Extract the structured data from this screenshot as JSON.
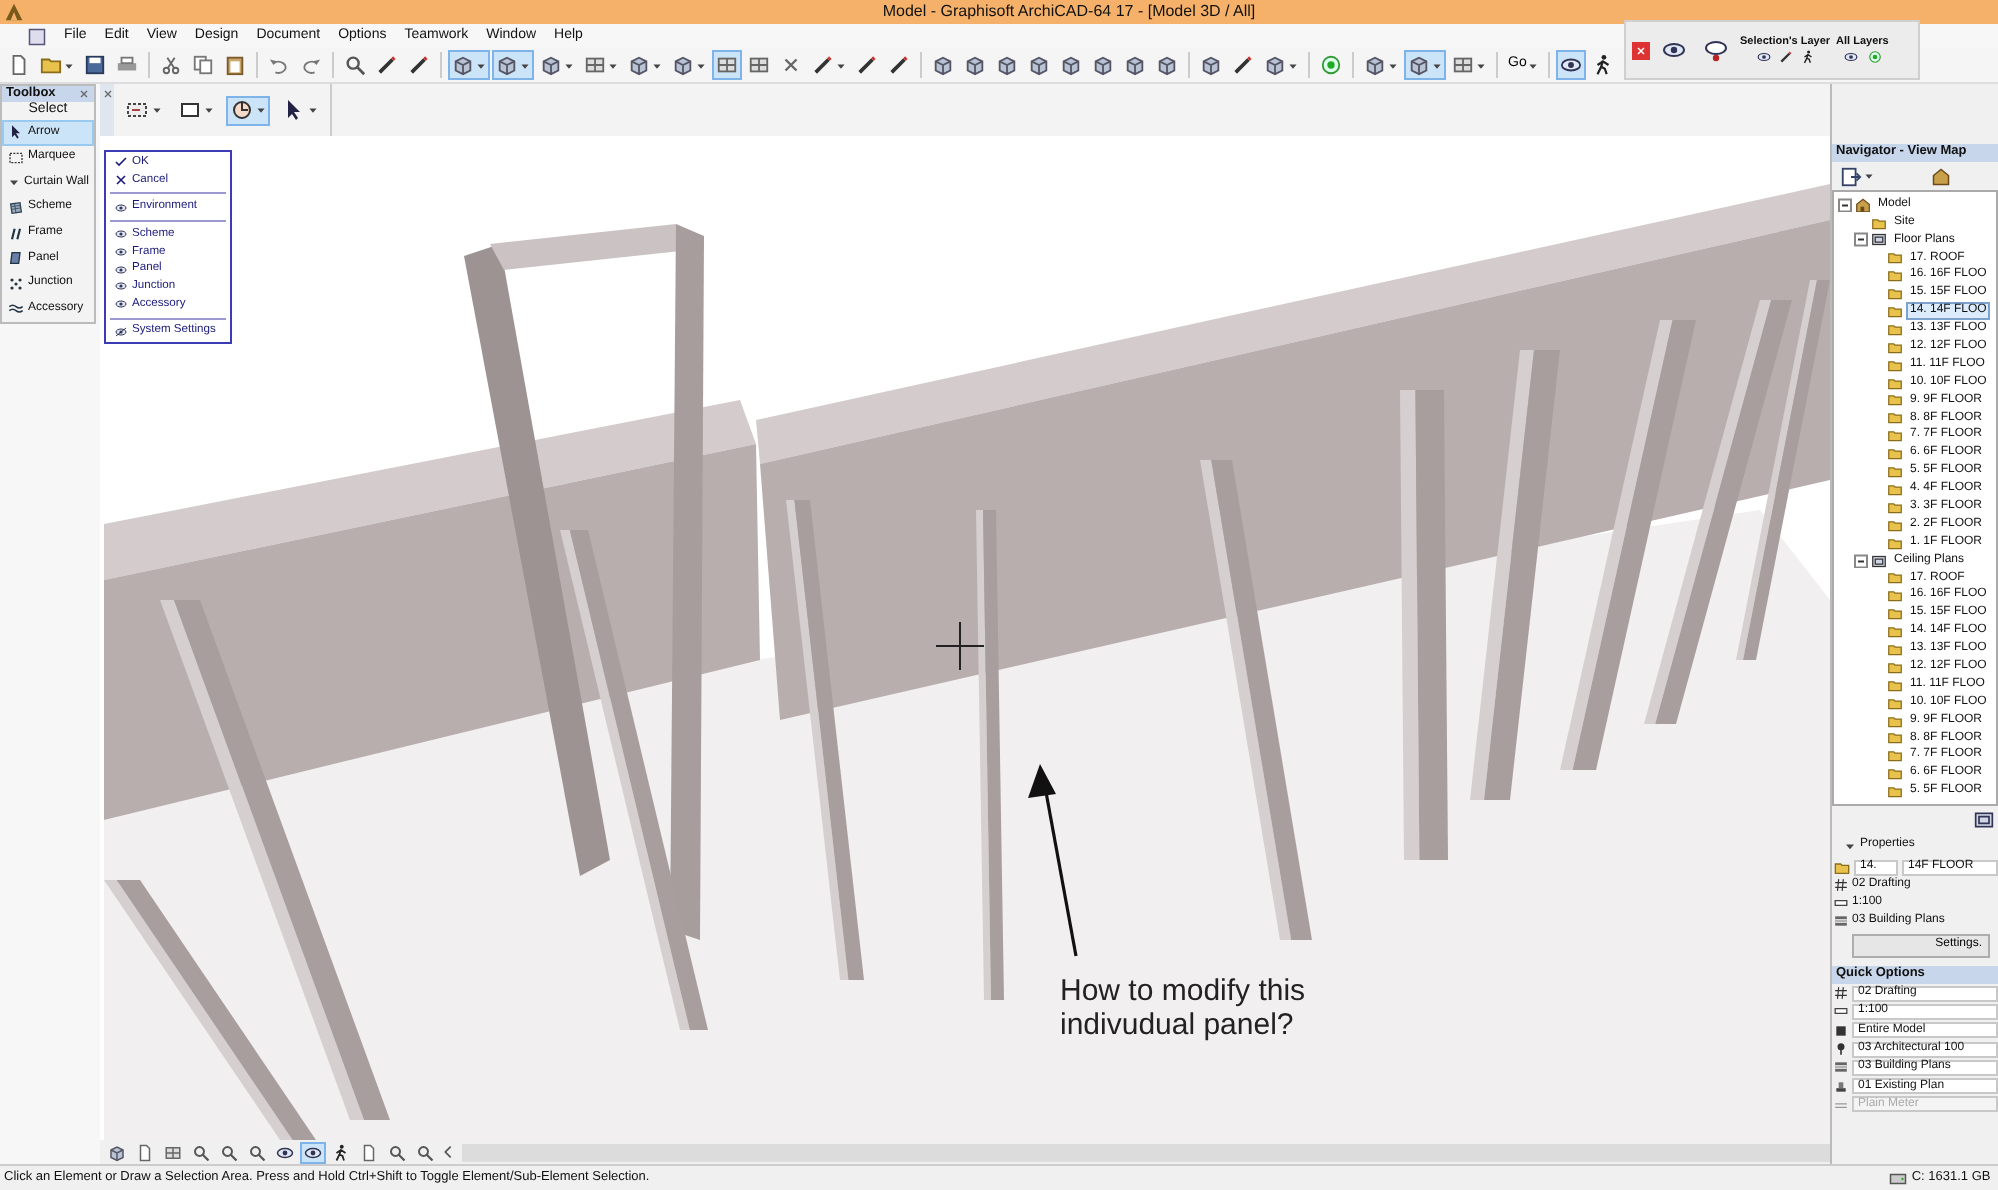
{
  "window": {
    "title": "Model - Graphisoft ArchiCAD-64 17 - [Model 3D / All]"
  },
  "menu": [
    "File",
    "Edit",
    "View",
    "Design",
    "Document",
    "Options",
    "Teamwork",
    "Window",
    "Help"
  ],
  "toolbar": {
    "buttons": [
      {
        "pressed": false
      },
      {
        "pressed": false
      },
      {
        "pressed": false
      },
      {
        "pressed": false
      },
      {
        "pressed": false
      },
      {
        "pressed": false
      },
      {
        "pressed": false
      },
      {
        "pressed": false
      },
      {
        "pressed": false
      },
      {
        "pressed": false
      },
      {
        "pressed": false
      },
      {
        "pressed": false
      },
      {
        "pressed": true
      },
      {
        "pressed": true
      },
      {
        "pressed": false
      },
      {
        "pressed": false
      },
      {
        "pressed": false
      },
      {
        "pressed": false
      },
      {
        "pressed": true
      },
      {
        "pressed": false
      },
      {
        "pressed": false
      },
      {
        "pressed": false
      },
      {
        "pressed": false
      },
      {
        "pressed": false
      },
      {
        "pressed": false
      },
      {
        "pressed": false
      },
      {
        "pressed": false
      },
      {
        "pressed": false
      },
      {
        "pressed": false
      },
      {
        "pressed": false
      },
      {
        "pressed": false
      },
      {
        "pressed": false
      },
      {
        "pressed": false
      },
      {
        "pressed": false
      },
      {
        "pressed": false
      },
      {
        "pressed": false
      },
      {
        "pressed": false
      },
      {
        "pressed": true
      },
      {
        "pressed": false
      },
      {
        "pressed": false,
        "label": "Go"
      },
      {
        "pressed": true
      },
      {
        "pressed": false
      }
    ]
  },
  "layers_palette": {
    "selection_layer": "Selection's Layer",
    "all_layers": "All Layers"
  },
  "info_box": {
    "buttons": [
      {
        "pressed": false
      },
      {
        "pressed": false
      },
      {
        "pressed": true
      },
      {
        "pressed": false
      }
    ]
  },
  "toolbox": {
    "title": "Toolbox",
    "section": "Select",
    "tools": [
      {
        "label": "Arrow",
        "selected": true
      },
      {
        "label": "Marquee",
        "selected": false
      }
    ],
    "group": {
      "label": "Curtain Wall",
      "expanded": true,
      "tools": [
        {
          "label": "Scheme",
          "selected": false
        },
        {
          "label": "Frame",
          "selected": false
        },
        {
          "label": "Panel",
          "selected": false
        },
        {
          "label": "Junction",
          "selected": false
        },
        {
          "label": "Accessory",
          "selected": false
        }
      ]
    }
  },
  "context_menu": {
    "items": [
      {
        "kind": "ok",
        "label": "OK"
      },
      {
        "kind": "cancel",
        "label": "Cancel"
      },
      {
        "kind": "separator"
      },
      {
        "kind": "eye",
        "label": "Environment"
      },
      {
        "kind": "separator"
      },
      {
        "kind": "eye",
        "label": "Scheme"
      },
      {
        "kind": "eye",
        "label": "Frame"
      },
      {
        "kind": "eye",
        "label": "Panel"
      },
      {
        "kind": "eye",
        "label": "Junction"
      },
      {
        "kind": "eye",
        "label": "Accessory"
      },
      {
        "kind": "separator"
      },
      {
        "kind": "settings",
        "label": "System Settings"
      }
    ]
  },
  "viewport": {
    "annotation": "How to modify this indivudual panel?"
  },
  "zoom_bar": {
    "buttons": [
      {
        "pressed": false
      },
      {
        "pressed": false
      },
      {
        "pressed": false
      },
      {
        "pressed": false
      },
      {
        "pressed": false
      },
      {
        "pressed": false
      },
      {
        "pressed": false
      },
      {
        "pressed": true
      },
      {
        "pressed": false
      },
      {
        "pressed": false
      },
      {
        "pressed": false
      },
      {
        "pressed": false
      }
    ]
  },
  "navigator": {
    "title": "Navigator - View Map",
    "tree": [
      {
        "label": "Model",
        "selected": false,
        "expanded": true,
        "children": [
          {
            "label": "Site",
            "selected": false
          },
          {
            "label": "Floor Plans",
            "selected": false,
            "expanded": true,
            "children": [
              {
                "label": "17. ROOF",
                "selected": false
              },
              {
                "label": "16. 16F FLOO",
                "selected": false
              },
              {
                "label": "15. 15F FLOO",
                "selected": false
              },
              {
                "label": "14. 14F FLOO",
                "selected": true
              },
              {
                "label": "13. 13F FLOO",
                "selected": false
              },
              {
                "label": "12. 12F FLOO",
                "selected": false
              },
              {
                "label": "11. 11F FLOO",
                "selected": false
              },
              {
                "label": "10. 10F FLOO",
                "selected": false
              },
              {
                "label": "9. 9F FLOOR",
                "selected": false
              },
              {
                "label": "8. 8F FLOOR",
                "selected": false
              },
              {
                "label": "7. 7F FLOOR",
                "selected": false
              },
              {
                "label": "6. 6F FLOOR",
                "selected": false
              },
              {
                "label": "5. 5F FLOOR",
                "selected": false
              },
              {
                "label": "4. 4F FLOOR",
                "selected": false
              },
              {
                "label": "3. 3F FLOOR",
                "selected": false
              },
              {
                "label": "2. 2F FLOOR",
                "selected": false
              },
              {
                "label": "1. 1F FLOOR",
                "selected": false
              }
            ]
          },
          {
            "label": "Ceiling Plans",
            "selected": false,
            "expanded": true,
            "children": [
              {
                "label": "17. ROOF",
                "selected": false
              },
              {
                "label": "16. 16F FLOO",
                "selected": false
              },
              {
                "label": "15. 15F FLOO",
                "selected": false
              },
              {
                "label": "14. 14F FLOO",
                "selected": false
              },
              {
                "label": "13. 13F FLOO",
                "selected": false
              },
              {
                "label": "12. 12F FLOO",
                "selected": false
              },
              {
                "label": "11. 11F FLOO",
                "selected": false
              },
              {
                "label": "10. 10F FLOO",
                "selected": false
              },
              {
                "label": "9. 9F FLOOR",
                "selected": false
              },
              {
                "label": "8. 8F FLOOR",
                "selected": false
              },
              {
                "label": "7. 7F FLOOR",
                "selected": false
              },
              {
                "label": "6. 6F FLOOR",
                "selected": false
              },
              {
                "label": "5. 5F FLOOR",
                "selected": false
              }
            ]
          }
        ]
      }
    ]
  },
  "properties": {
    "title": "Properties",
    "expanded": true,
    "number": "14.",
    "name": "14F FLOOR",
    "rows": [
      "02 Drafting",
      "1:100",
      "03 Building Plans"
    ],
    "button": "Settings."
  },
  "quick_options": {
    "title": "Quick Options",
    "rows": [
      {
        "label": "02 Drafting",
        "disabled": false
      },
      {
        "label": "1:100",
        "disabled": false
      },
      {
        "label": "Entire Model",
        "disabled": false
      },
      {
        "label": "03 Architectural 100",
        "disabled": false
      },
      {
        "label": "03 Building Plans",
        "disabled": false
      },
      {
        "label": "01 Existing Plan",
        "disabled": false
      },
      {
        "label": "Plain Meter",
        "disabled": true
      }
    ]
  },
  "status_bar": {
    "message": "Click an Element or Draw a Selection Area. Press and Hold Ctrl+Shift to Toggle Element/Sub-Element Selection.",
    "disk": "C: 1631.1 GB"
  }
}
